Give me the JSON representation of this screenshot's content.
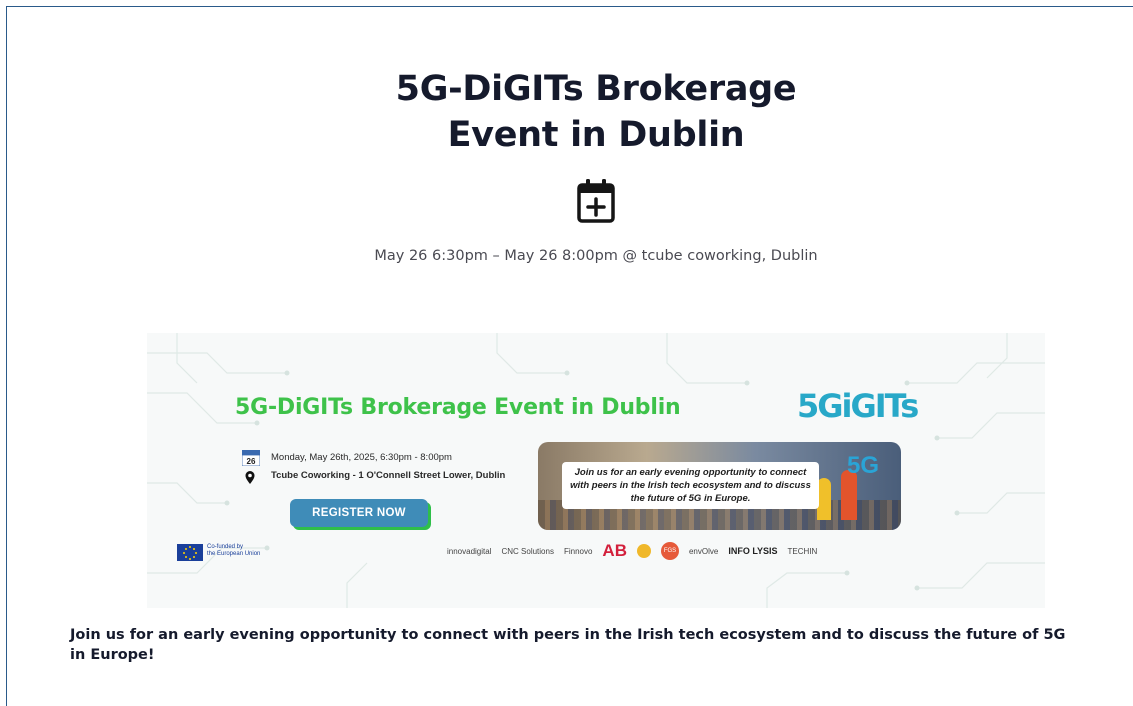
{
  "event": {
    "title_line1": "5G-DiGITs Brokerage",
    "title_line2": "Event in Dublin",
    "add_to_calendar_icon": "calendar-plus-icon",
    "datetime_location": "May 26 6:30pm – May 26 8:00pm @  tcube coworking, Dublin",
    "description": "Join us for an early evening opportunity to connect with peers in the Irish tech ecosystem and to discuss the future of 5G in Europe!"
  },
  "banner": {
    "title": "5G-DiGITs Brokerage Event in Dublin",
    "logo_text": "5GiGITs",
    "date_icon_label": "26",
    "date_line": "Monday, May 26th, 2025, 6:30pm - 8:00pm",
    "location_line": "Tcube Coworking - 1 O'Connell Street Lower, Dublin",
    "register_label": "REGISTER NOW",
    "photo_caption": "Join us for an early evening opportunity to connect with peers in the Irish tech ecosystem and to discuss the future of 5G in Europe.",
    "photo_badge": "5G",
    "eu_text_line1": "Co-funded by",
    "eu_text_line2": "the European Union",
    "partners": [
      "innovadigital",
      "CNC Solutions",
      "Finnovo",
      "AB",
      "FGS",
      "envOlve",
      "INFO LYSIS",
      "TECHIN"
    ],
    "colors": {
      "title_green": "#3ec24a",
      "button_blue": "#3f8cb8",
      "logo_blue": "#28a8c8"
    }
  }
}
